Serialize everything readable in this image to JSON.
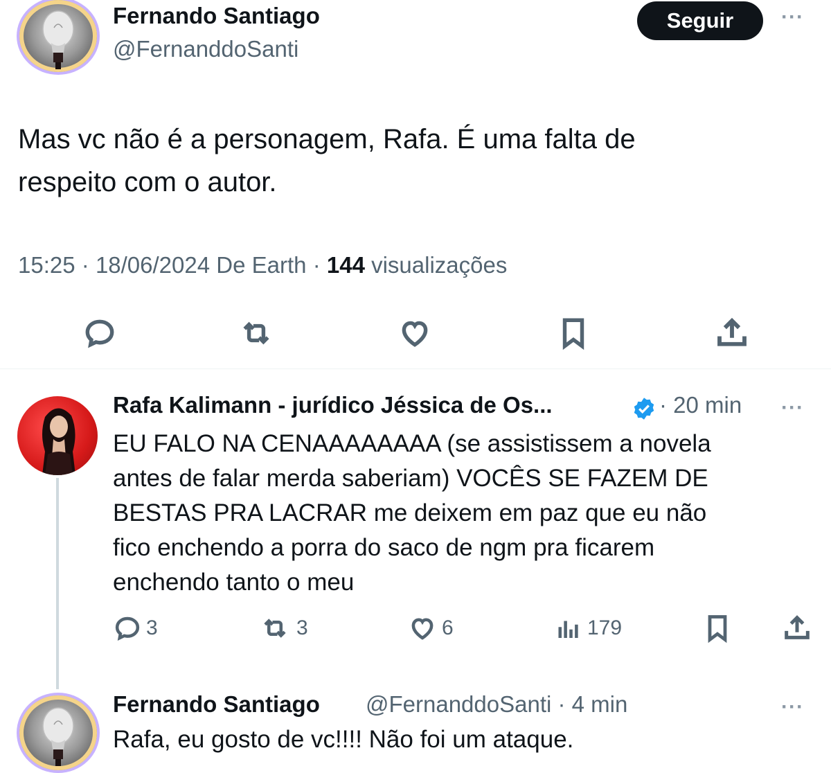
{
  "tweet": {
    "author_name": "Fernando Santiago",
    "author_handle": "@FernanddoSanti",
    "follow_label": "Seguir",
    "more_label": "···",
    "text_line1": "Mas vc não é a personagem, Rafa. É uma falta de",
    "text_line2": "respeito com o autor.",
    "time": "15:25",
    "date": "18/06/2024",
    "source": "De Earth",
    "views_count": "144",
    "views_label": "visualizações",
    "separator": "·"
  },
  "icons": {
    "reply": "reply-icon",
    "retweet": "retweet-icon",
    "like": "like-icon",
    "bookmark": "bookmark-icon",
    "share": "share-icon",
    "views": "views-icon",
    "verified": "verified-badge-icon"
  },
  "reply1": {
    "author_name": "Rafa Kalimann - jurídico Jéssica de Os...",
    "time": "· 20 min",
    "more_label": "···",
    "lines": [
      "EU FALO NA CENAAAAAAAA (se assistissem a novela",
      "antes de falar merda saberiam) VOCÊS SE FAZEM DE",
      "BESTAS PRA LACRAR me deixem em paz que eu não",
      "fico enchendo a porra do saco de ngm pra ficarem",
      "enchendo tanto o meu"
    ],
    "replies": "3",
    "retweets": "3",
    "likes": "6",
    "views": "179"
  },
  "reply2": {
    "author_name": "Fernando Santiago",
    "author_handle": "@FernanddoSanti · 4 min",
    "more_label": "···",
    "text": "Rafa, eu gosto de vc!!!! Não foi um ataque."
  },
  "colors": {
    "text": "#0f1419",
    "secondary": "#536471",
    "verified": "#1d9bf0",
    "button_bg": "#0f1419"
  }
}
